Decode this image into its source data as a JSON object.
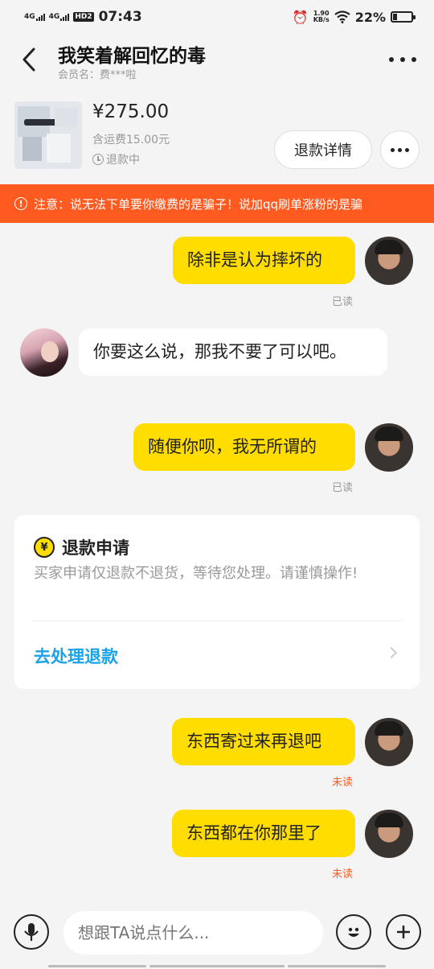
{
  "status_bar": {
    "net1": "4G",
    "net2": "4G",
    "hd": "HD2",
    "time": "07:43",
    "speed_value": "1.90",
    "speed_unit": "KB/s",
    "battery": "22%"
  },
  "header": {
    "title": "我笑着解回忆的毒",
    "member_label": "会员名：费***啦"
  },
  "order": {
    "price": "¥275.00",
    "shipping": "含运费15.00元",
    "status": "退款中",
    "refund_detail_label": "退款详情"
  },
  "warning": {
    "text": "注意：说无法下单要你缴费的是骗子！说加qq刷单涨粉的是骗"
  },
  "messages": [
    {
      "sender": "me",
      "text": "除非是认为摔坏的",
      "status": "已读"
    },
    {
      "sender": "other",
      "text": "你要这么说，那我不要了可以吧。"
    },
    {
      "sender": "me",
      "text": "随便你呗，我无所谓的",
      "status": "已读"
    },
    {
      "sender": "me",
      "text": "东西寄过来再退吧",
      "status": "未读"
    },
    {
      "sender": "me",
      "text": "东西都在你那里了",
      "status": "未读"
    }
  ],
  "refund_card": {
    "icon_glyph": "¥",
    "title": "退款申请",
    "description": "买家申请仅退款不退货，等待您处理。请谨慎操作!",
    "action": "去处理退款"
  },
  "input_bar": {
    "placeholder": "想跟TA说点什么..."
  },
  "colors": {
    "accent_yellow": "#ffdd00",
    "warning_orange": "#ff5a1f",
    "link_blue": "#1aa3e8"
  },
  "icons": [
    "back-arrow-icon",
    "more-icon",
    "clock-icon",
    "warning-icon",
    "yen-icon",
    "chevron-right-icon",
    "microphone-icon",
    "emoji-icon",
    "plus-icon"
  ]
}
